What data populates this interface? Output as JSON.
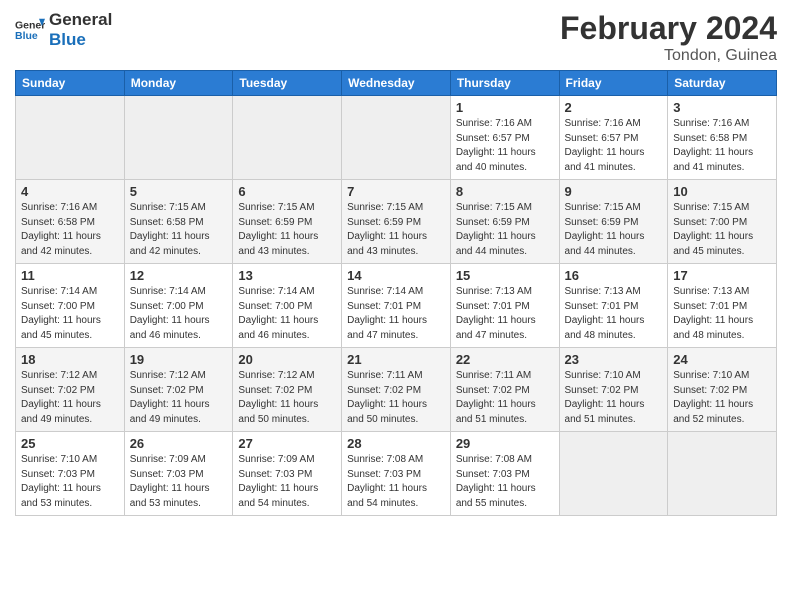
{
  "header": {
    "logo_line1": "General",
    "logo_line2": "Blue",
    "month": "February 2024",
    "location": "Tondon, Guinea"
  },
  "days_of_week": [
    "Sunday",
    "Monday",
    "Tuesday",
    "Wednesday",
    "Thursday",
    "Friday",
    "Saturday"
  ],
  "weeks": [
    [
      {
        "day": "",
        "info": ""
      },
      {
        "day": "",
        "info": ""
      },
      {
        "day": "",
        "info": ""
      },
      {
        "day": "",
        "info": ""
      },
      {
        "day": "1",
        "info": "Sunrise: 7:16 AM\nSunset: 6:57 PM\nDaylight: 11 hours\nand 40 minutes."
      },
      {
        "day": "2",
        "info": "Sunrise: 7:16 AM\nSunset: 6:57 PM\nDaylight: 11 hours\nand 41 minutes."
      },
      {
        "day": "3",
        "info": "Sunrise: 7:16 AM\nSunset: 6:58 PM\nDaylight: 11 hours\nand 41 minutes."
      }
    ],
    [
      {
        "day": "4",
        "info": "Sunrise: 7:16 AM\nSunset: 6:58 PM\nDaylight: 11 hours\nand 42 minutes."
      },
      {
        "day": "5",
        "info": "Sunrise: 7:15 AM\nSunset: 6:58 PM\nDaylight: 11 hours\nand 42 minutes."
      },
      {
        "day": "6",
        "info": "Sunrise: 7:15 AM\nSunset: 6:59 PM\nDaylight: 11 hours\nand 43 minutes."
      },
      {
        "day": "7",
        "info": "Sunrise: 7:15 AM\nSunset: 6:59 PM\nDaylight: 11 hours\nand 43 minutes."
      },
      {
        "day": "8",
        "info": "Sunrise: 7:15 AM\nSunset: 6:59 PM\nDaylight: 11 hours\nand 44 minutes."
      },
      {
        "day": "9",
        "info": "Sunrise: 7:15 AM\nSunset: 6:59 PM\nDaylight: 11 hours\nand 44 minutes."
      },
      {
        "day": "10",
        "info": "Sunrise: 7:15 AM\nSunset: 7:00 PM\nDaylight: 11 hours\nand 45 minutes."
      }
    ],
    [
      {
        "day": "11",
        "info": "Sunrise: 7:14 AM\nSunset: 7:00 PM\nDaylight: 11 hours\nand 45 minutes."
      },
      {
        "day": "12",
        "info": "Sunrise: 7:14 AM\nSunset: 7:00 PM\nDaylight: 11 hours\nand 46 minutes."
      },
      {
        "day": "13",
        "info": "Sunrise: 7:14 AM\nSunset: 7:00 PM\nDaylight: 11 hours\nand 46 minutes."
      },
      {
        "day": "14",
        "info": "Sunrise: 7:14 AM\nSunset: 7:01 PM\nDaylight: 11 hours\nand 47 minutes."
      },
      {
        "day": "15",
        "info": "Sunrise: 7:13 AM\nSunset: 7:01 PM\nDaylight: 11 hours\nand 47 minutes."
      },
      {
        "day": "16",
        "info": "Sunrise: 7:13 AM\nSunset: 7:01 PM\nDaylight: 11 hours\nand 48 minutes."
      },
      {
        "day": "17",
        "info": "Sunrise: 7:13 AM\nSunset: 7:01 PM\nDaylight: 11 hours\nand 48 minutes."
      }
    ],
    [
      {
        "day": "18",
        "info": "Sunrise: 7:12 AM\nSunset: 7:02 PM\nDaylight: 11 hours\nand 49 minutes."
      },
      {
        "day": "19",
        "info": "Sunrise: 7:12 AM\nSunset: 7:02 PM\nDaylight: 11 hours\nand 49 minutes."
      },
      {
        "day": "20",
        "info": "Sunrise: 7:12 AM\nSunset: 7:02 PM\nDaylight: 11 hours\nand 50 minutes."
      },
      {
        "day": "21",
        "info": "Sunrise: 7:11 AM\nSunset: 7:02 PM\nDaylight: 11 hours\nand 50 minutes."
      },
      {
        "day": "22",
        "info": "Sunrise: 7:11 AM\nSunset: 7:02 PM\nDaylight: 11 hours\nand 51 minutes."
      },
      {
        "day": "23",
        "info": "Sunrise: 7:10 AM\nSunset: 7:02 PM\nDaylight: 11 hours\nand 51 minutes."
      },
      {
        "day": "24",
        "info": "Sunrise: 7:10 AM\nSunset: 7:02 PM\nDaylight: 11 hours\nand 52 minutes."
      }
    ],
    [
      {
        "day": "25",
        "info": "Sunrise: 7:10 AM\nSunset: 7:03 PM\nDaylight: 11 hours\nand 53 minutes."
      },
      {
        "day": "26",
        "info": "Sunrise: 7:09 AM\nSunset: 7:03 PM\nDaylight: 11 hours\nand 53 minutes."
      },
      {
        "day": "27",
        "info": "Sunrise: 7:09 AM\nSunset: 7:03 PM\nDaylight: 11 hours\nand 54 minutes."
      },
      {
        "day": "28",
        "info": "Sunrise: 7:08 AM\nSunset: 7:03 PM\nDaylight: 11 hours\nand 54 minutes."
      },
      {
        "day": "29",
        "info": "Sunrise: 7:08 AM\nSunset: 7:03 PM\nDaylight: 11 hours\nand 55 minutes."
      },
      {
        "day": "",
        "info": ""
      },
      {
        "day": "",
        "info": ""
      }
    ]
  ]
}
